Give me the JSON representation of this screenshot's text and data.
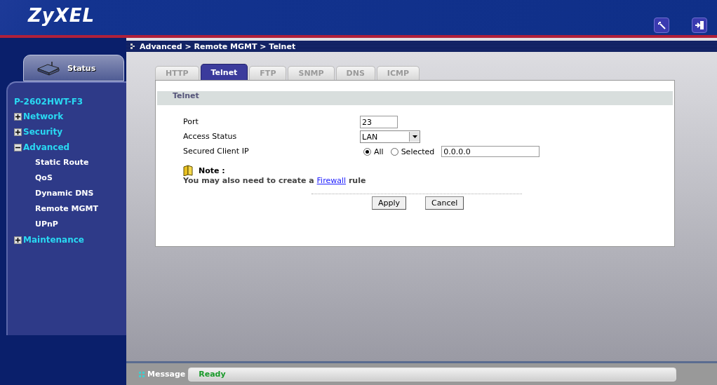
{
  "header": {
    "logo": "ZyXEL"
  },
  "breadcrumb": "Advanced > Remote MGMT > Telnet",
  "sidebar": {
    "status_tab": "Status",
    "device": "P-2602HWT-F3",
    "items": [
      {
        "label": "Network",
        "expanded": false
      },
      {
        "label": "Security",
        "expanded": false
      },
      {
        "label": "Advanced",
        "expanded": true,
        "children": [
          {
            "label": "Static Route"
          },
          {
            "label": "QoS"
          },
          {
            "label": "Dynamic DNS"
          },
          {
            "label": "Remote MGMT"
          },
          {
            "label": "UPnP"
          }
        ]
      },
      {
        "label": "Maintenance",
        "expanded": false
      }
    ]
  },
  "tabs": [
    {
      "label": "HTTP",
      "selected": false
    },
    {
      "label": "Telnet",
      "selected": true
    },
    {
      "label": "FTP",
      "selected": false
    },
    {
      "label": "SNMP",
      "selected": false
    },
    {
      "label": "DNS",
      "selected": false
    },
    {
      "label": "ICMP",
      "selected": false
    }
  ],
  "section_title": "Telnet",
  "form": {
    "port": {
      "label": "Port",
      "value": "23"
    },
    "access_status": {
      "label": "Access Status",
      "value": "LAN"
    },
    "secured_client_ip": {
      "label": "Secured Client IP",
      "options": [
        {
          "label": "All",
          "selected": true
        },
        {
          "label": "Selected",
          "selected": false
        }
      ],
      "value": "0.0.0.0"
    }
  },
  "note": {
    "title": "Note :",
    "text_before": "You may also need to create a",
    "link": "Firewall",
    "text_after": "rule"
  },
  "buttons": [
    "Apply",
    "Cancel"
  ],
  "status_bar": {
    "label": "Message",
    "value": "Ready"
  }
}
